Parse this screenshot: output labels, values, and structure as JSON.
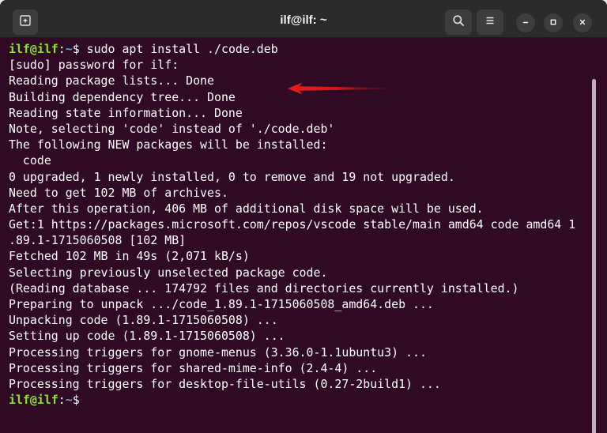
{
  "window": {
    "title": "ilf@ilf: ~",
    "buttons": {
      "new_tab": "new-tab-icon",
      "search": "search-icon",
      "menu": "hamburger-menu-icon",
      "minimize": "minimize-icon",
      "maximize": "maximize-icon",
      "close": "close-icon"
    }
  },
  "terminal": {
    "prompt": {
      "user": "ilf@ilf",
      "sep": ":",
      "path": "~",
      "symbol": "$ "
    },
    "command": "sudo apt install ./code.deb",
    "output": [
      "[sudo] password for ilf:",
      "Reading package lists... Done",
      "Building dependency tree... Done",
      "Reading state information... Done",
      "Note, selecting 'code' instead of './code.deb'",
      "The following NEW packages will be installed:",
      "  code",
      "0 upgraded, 1 newly installed, 0 to remove and 19 not upgraded.",
      "Need to get 102 MB of archives.",
      "After this operation, 406 MB of additional disk space will be used.",
      "Get:1 https://packages.microsoft.com/repos/vscode stable/main amd64 code amd64 1",
      ".89.1-1715060508 [102 MB]",
      "Fetched 102 MB in 49s (2,071 kB/s)",
      "Selecting previously unselected package code.",
      "(Reading database ... 174792 files and directories currently installed.)",
      "Preparing to unpack .../code_1.89.1-1715060508_amd64.deb ...",
      "Unpacking code (1.89.1-1715060508) ...",
      "Setting up code (1.89.1-1715060508) ...",
      "Processing triggers for gnome-menus (3.36.0-1.1ubuntu3) ...",
      "Processing triggers for shared-mime-info (2.4-4) ...",
      "Processing triggers for desktop-file-utils (0.27-2build1) ..."
    ]
  },
  "colors": {
    "terminal_bg": "#300a24",
    "titlebar_bg": "#2b2b2b",
    "prompt_user": "#8ae234",
    "prompt_path": "#729fcf",
    "text": "#ffffff",
    "arrow": "#e31c1c"
  }
}
